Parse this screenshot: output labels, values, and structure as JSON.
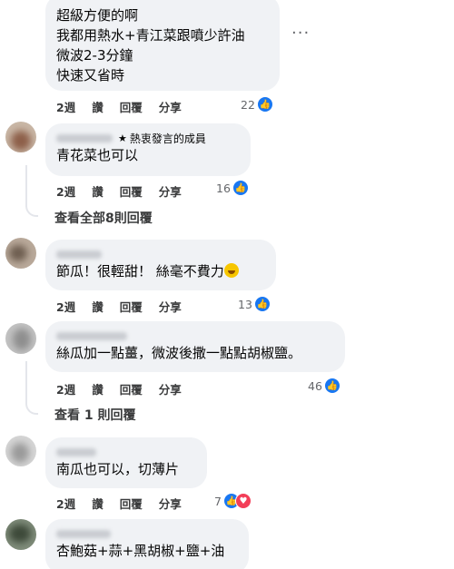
{
  "comments": [
    {
      "id": "c1",
      "text": "超級方便的啊\n我都用熱水+青江菜跟噴少許油\n微波2-3分鐘\n快速又省時",
      "time": "2週",
      "like_label": "讚",
      "reply_label": "回覆",
      "share_label": "分享",
      "reactions": "22",
      "more": "···"
    },
    {
      "id": "c2",
      "badge": "熱衷發言的成員",
      "text": "青花菜也可以",
      "time": "2週",
      "like_label": "讚",
      "reply_label": "回覆",
      "share_label": "分享",
      "reactions": "16"
    },
    {
      "id": "c3",
      "text": "節瓜！很輕甜！ 絲毫不費力",
      "time": "2週",
      "like_label": "讚",
      "reply_label": "回覆",
      "share_label": "分享",
      "reactions": "13"
    },
    {
      "id": "c4",
      "text": "絲瓜加一點薑，微波後撒一點點胡椒鹽。",
      "time": "2週",
      "like_label": "讚",
      "reply_label": "回覆",
      "share_label": "分享",
      "reactions": "46"
    },
    {
      "id": "c5",
      "text": "南瓜也可以，切薄片",
      "time": "2週",
      "like_label": "讚",
      "reply_label": "回覆",
      "share_label": "分享",
      "reactions": "7"
    },
    {
      "id": "c6",
      "text": "杏鮑菇+蒜+黑胡椒+鹽+油"
    }
  ],
  "view_more_replies_1": "查看全部8則回覆",
  "view_more_replies_2": "查看 1 則回覆",
  "colors": {
    "bubble": "#f0f2f5",
    "like": "#1877f2",
    "love": "#f33e58"
  },
  "icons": {
    "like": "thumbs-up-icon",
    "love": "heart-icon",
    "badge": "star-icon",
    "more": "more-dots-icon"
  }
}
